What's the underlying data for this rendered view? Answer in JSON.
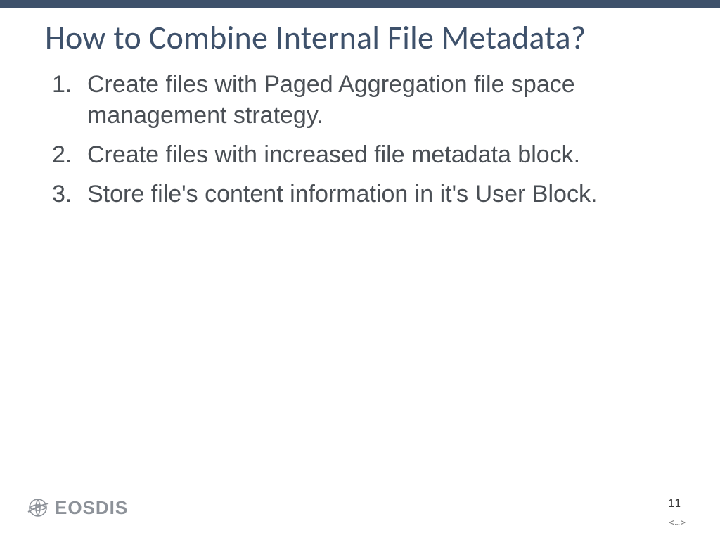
{
  "title": "How to Combine Internal File Metadata?",
  "items": [
    "Create files with Paged Aggregation file space management strategy.",
    "Create files with increased file metadata block.",
    "Store file's content information in it's User Block."
  ],
  "logo_text": "EOSDIS",
  "page_number": "11",
  "nav_marker": "<…>"
}
